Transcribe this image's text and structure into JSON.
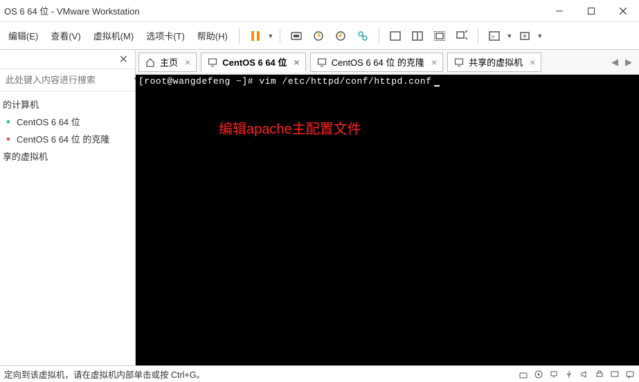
{
  "window": {
    "title": "OS 6 64 位 - VMware Workstation"
  },
  "menu": {
    "edit": "编辑(E)",
    "view": "查看(V)",
    "vm": "虚拟机(M)",
    "tabs": "选项卡(T)",
    "help": "帮助(H)"
  },
  "sidebar": {
    "search_placeholder": "此处键入内容进行搜索",
    "items": [
      {
        "label": "的计算机",
        "icon": ""
      },
      {
        "label": "CentOS 6 64 位",
        "icon": "●"
      },
      {
        "label": "CentOS 6 64 位 的克隆",
        "icon": "●"
      },
      {
        "label": "享的虚拟机",
        "icon": ""
      }
    ]
  },
  "tabs": [
    {
      "label": "主页",
      "active": false,
      "icon": "home"
    },
    {
      "label": "CentOS 6 64 位",
      "active": true,
      "icon": "vm"
    },
    {
      "label": "CentOS 6 64 位 的克隆",
      "active": false,
      "icon": "vm"
    },
    {
      "label": "共享的虚拟机",
      "active": false,
      "icon": "vm"
    }
  ],
  "terminal": {
    "line1": "[root@wangdefeng ~]# vim /etc/httpd/conf/httpd.conf",
    "annotation": "编辑apache主配置文件"
  },
  "statusbar": {
    "message": "定向到该虚拟机，请在虚拟机内部单击或按 Ctrl+G。"
  }
}
